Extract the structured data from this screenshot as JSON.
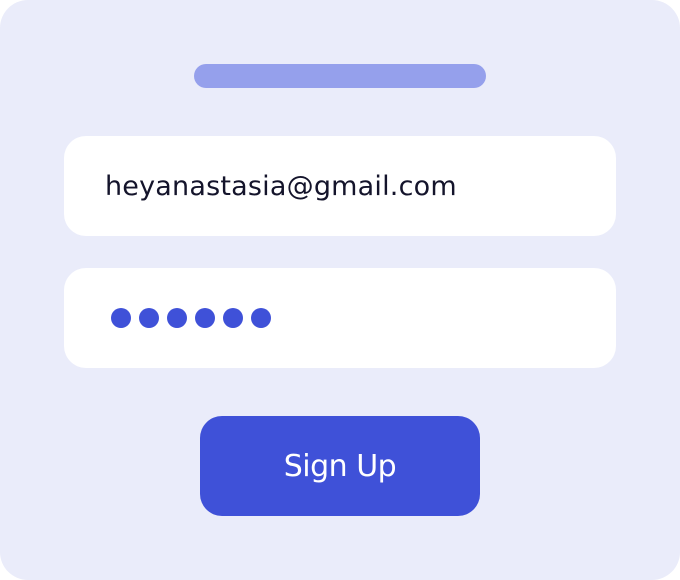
{
  "form": {
    "email_value": "heyanastasia@gmail.com",
    "password_mask_count": 6,
    "signup_label": "Sign Up"
  },
  "colors": {
    "background": "#eaecfa",
    "title_bar": "#95a0ec",
    "accent": "#3f51d8",
    "field_background": "#ffffff",
    "text": "#14142b"
  }
}
